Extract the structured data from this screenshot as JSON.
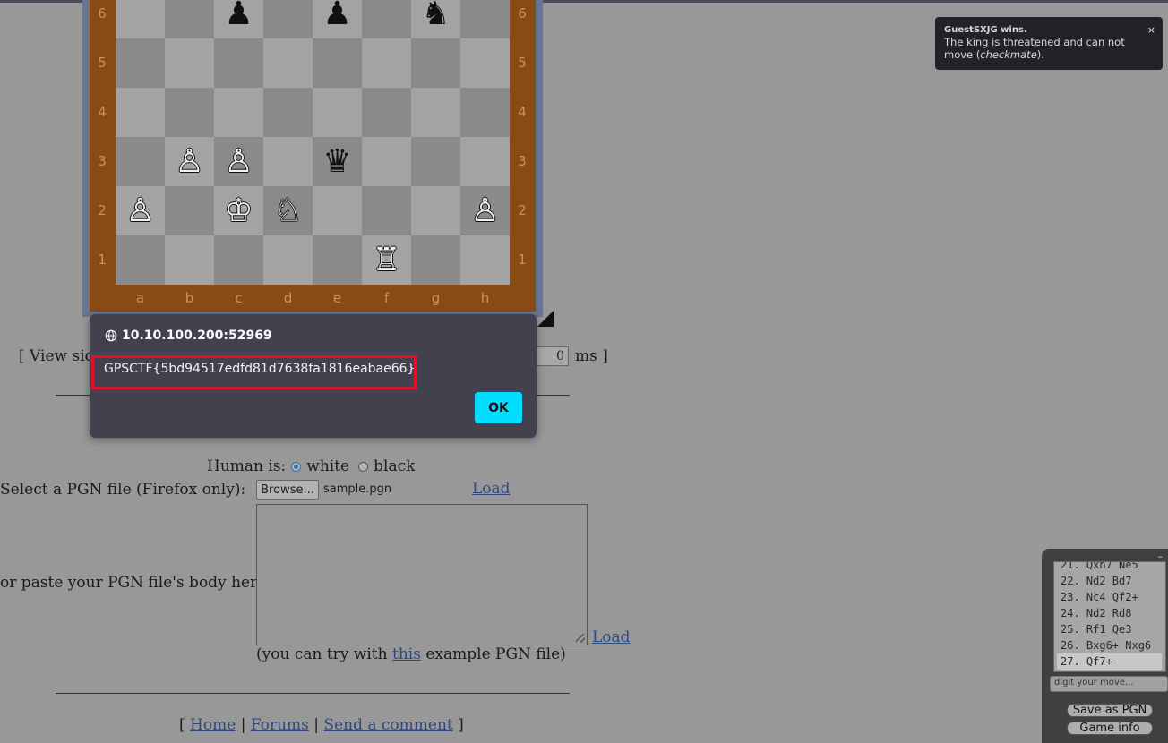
{
  "board": {
    "ranks": [
      "6",
      "5",
      "4",
      "3",
      "2",
      "1"
    ],
    "files": [
      "a",
      "b",
      "c",
      "d",
      "e",
      "f",
      "g",
      "h"
    ],
    "pieces": [
      {
        "square": "c6",
        "glyph": "♟",
        "color": "black",
        "name": "black-pawn"
      },
      {
        "square": "e6",
        "glyph": "♟",
        "color": "black",
        "name": "black-pawn"
      },
      {
        "square": "g6",
        "glyph": "♞",
        "color": "black",
        "name": "black-knight"
      },
      {
        "square": "b3",
        "glyph": "♙",
        "color": "white",
        "name": "white-pawn"
      },
      {
        "square": "c3",
        "glyph": "♙",
        "color": "white",
        "name": "white-pawn"
      },
      {
        "square": "e3",
        "glyph": "♛",
        "color": "black",
        "name": "black-queen"
      },
      {
        "square": "a2",
        "glyph": "♙",
        "color": "white",
        "name": "white-pawn"
      },
      {
        "square": "c2",
        "glyph": "♔",
        "color": "white",
        "name": "white-king"
      },
      {
        "square": "d2",
        "glyph": "♘",
        "color": "white",
        "name": "white-knight"
      },
      {
        "square": "h2",
        "glyph": "♙",
        "color": "white",
        "name": "white-pawn"
      },
      {
        "square": "f1",
        "glyph": "♖",
        "color": "white",
        "name": "white-rook"
      }
    ]
  },
  "options": {
    "view_side_text": "[ View sid",
    "ms_value": "0",
    "ms_label": "ms ]"
  },
  "human": {
    "label": "Human is:",
    "white": "white",
    "black": "black",
    "selected": "white"
  },
  "pgn": {
    "select_label": "Select a PGN file (Firefox only):",
    "browse_label": "Browse...",
    "file_name": "sample.pgn",
    "load_label": "Load",
    "paste_label": "or paste your PGN file's body here:",
    "textarea_value": "",
    "try_prefix": "(you can try with ",
    "try_link": "this",
    "try_suffix": " example PGN file)"
  },
  "footer": {
    "open": "[ ",
    "home": "Home",
    "sep": " | ",
    "forums": "Forums",
    "comment": "Send a comment",
    "close": " ]"
  },
  "notification": {
    "title": "GuestSXJG wins.",
    "body_prefix": "The king is threatened and can not move (",
    "body_em": "checkmate",
    "body_suffix": ").",
    "close": "×"
  },
  "moves": {
    "items": [
      "21. Qxh7 Ne5",
      "22. Nd2 Bd7",
      "23. Nc4 Qf2+",
      "24. Nd2 Rd8",
      "25. Rf1 Qe3",
      "26. Bxg6+ Nxg6",
      "27. Qf7+"
    ],
    "selected_index": 6,
    "input_placeholder": "digit your move...",
    "save_label": "Save as PGN",
    "info_label": "Game info",
    "minimize": "–"
  },
  "dialog": {
    "origin": "10.10.100.200:52969",
    "message": "GPSCTF{5bd94517edfd81d7638fa1816eabae66}",
    "ok_label": "OK"
  },
  "colors": {
    "accent": "#00ddff",
    "highlight": "#e0102a",
    "dialog_bg": "#42414d",
    "board_wood": "#8a4a13"
  }
}
